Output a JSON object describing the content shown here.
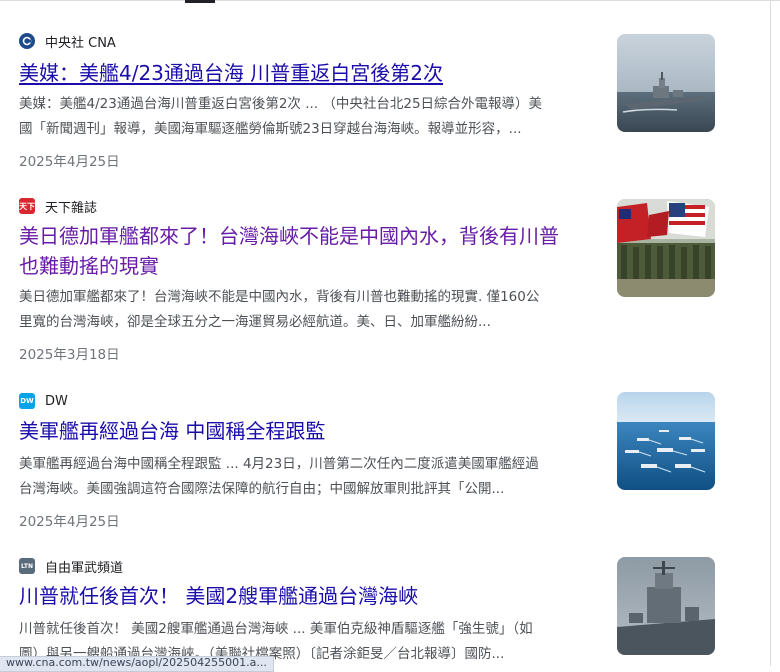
{
  "results": [
    {
      "source": "中央社 CNA",
      "favicon": "cna-favicon",
      "title": "美媒：美艦4/23通過台海 川普重返白宮後第2次",
      "snippet_line1": "美媒：美艦4/23通過台海川普重返白宮後第2次 ... （中央社台北25日綜合外電報導）美",
      "snippet_line2": "國「新聞週刊」報導，美國海軍驅逐艦勞倫斯號23日穿越台海海峽。報導並形容，...",
      "date": "2025年4月25日",
      "thumbnail": "destroyer-at-sea-image"
    },
    {
      "source": "天下雜誌",
      "favicon": "cw-favicon",
      "favicon_text": "天下",
      "title_line1": "美日德加軍艦都來了！台灣海峽不能是中國內水，背後有川普",
      "title_line2": "也難動搖的現實",
      "snippet_line1": "美日德加軍艦都來了！台灣海峽不能是中國內水，背後有川普也難動搖的現實. 僅160公",
      "snippet_line2": "里寬的台灣海峽，卻是全球五分之一海運貿易必經航道。美、日、加軍艦紛紛...",
      "date": "2025年3月18日",
      "thumbnail": "soldiers-with-flags-image"
    },
    {
      "source": "DW",
      "favicon": "dw-favicon",
      "favicon_text": "DW",
      "title": "美軍艦再經過台海 中國稱全程跟監",
      "snippet_line1": "美軍艦再經過台海中國稱全程跟監 ... 4月23日，川普第二次任內二度派遣美國軍艦經過",
      "snippet_line2": "台灣海峽。美國強調這符合國際法保障的航行自由；中國解放軍則批評其「公開...",
      "date": "2025年4月25日",
      "thumbnail": "naval-fleet-aerial-image"
    },
    {
      "source": "自由軍武頻道",
      "favicon": "ltn-favicon",
      "favicon_text": "LTN",
      "title": "川普就任後首次！ 美國2艘軍艦通過台灣海峽",
      "snippet_line1": "川普就任後首次！ 美國2艘軍艦通過台灣海峽 ... 美軍伯克級神盾驅逐艦「強生號」（如",
      "snippet_line2": "圖）與另一艘船通過台灣海峽。（美聯社檔案照）〔記者涂鉅旻／台北報導〕國防...",
      "thumbnail": "destroyer-deck-image"
    }
  ],
  "status_url": "www.cna.com.tw/news/aopl/202504255001.a..."
}
